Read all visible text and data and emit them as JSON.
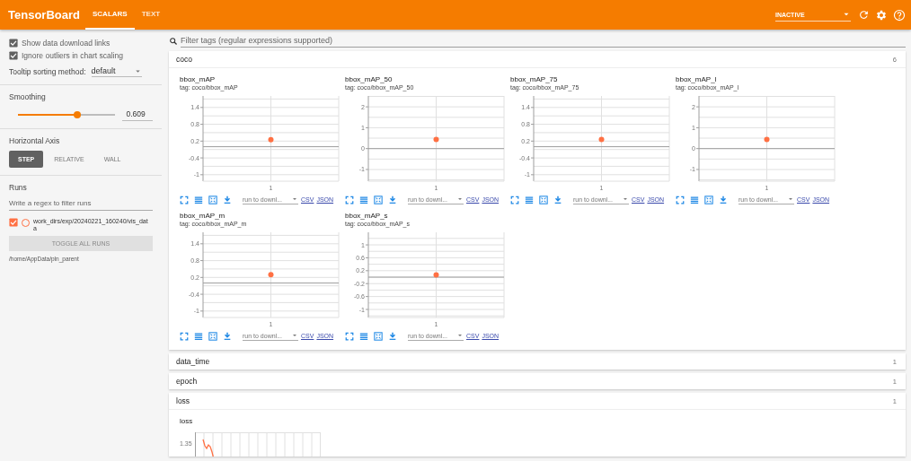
{
  "header": {
    "title": "TensorBoard",
    "tabs": [
      {
        "label": "SCALARS",
        "selected": true
      },
      {
        "label": "TEXT",
        "selected": false
      }
    ],
    "run_status": "INACTIVE"
  },
  "sidebar": {
    "options": [
      {
        "label": "Show data download links",
        "checked": true
      },
      {
        "label": "Ignore outliers in chart scaling",
        "checked": true
      }
    ],
    "tooltip_sorting": {
      "label": "Tooltip sorting method:",
      "value": "default"
    },
    "smoothing": {
      "label": "Smoothing",
      "level": 0.609,
      "reading": "0.609"
    },
    "horizontal_axis": {
      "label": "Horizontal Axis",
      "options": [
        {
          "label": "STEP",
          "selected": true
        },
        {
          "label": "RELATIVE",
          "selected": false
        },
        {
          "label": "WALL",
          "selected": false
        }
      ]
    },
    "runs": {
      "label": "Runs",
      "filter_placeholder": "Write a regex to filter runs",
      "items": [
        {
          "name": "work_dirs/exp/20240221_160240/vis_data",
          "checked": true,
          "selected": false,
          "color": "#ff7043"
        }
      ],
      "toggle_button": "TOGGLE ALL RUNS",
      "log_dir": "/home/AppData/pln_parent"
    }
  },
  "main": {
    "search_placeholder": "Filter tags (regular expressions supported)",
    "categories": [
      {
        "name": "coco",
        "count": "6",
        "expanded": true,
        "kind": "charts",
        "charts": [
          {
            "title": "bbox_mAP",
            "tag": "tag: coco/bbox_mAP",
            "download_placeholder": "run to downl...",
            "links": [
              "CSV",
              "JSON"
            ],
            "chart_data": {
              "type": "scatter",
              "categories": [
                "1"
              ],
              "grid": true,
              "ylim": [
                -1.23,
                1.81
              ],
              "yticks": [
                1.4,
                0.8,
                0.2,
                -0.4,
                -1
              ],
              "series": [
                {
                  "color": "#ff7043",
                  "values": [
                    0.25
                  ]
                }
              ]
            }
          },
          {
            "title": "bbox_mAP_50",
            "tag": "tag: coco/bbox_mAP_50",
            "download_placeholder": "run to downl...",
            "links": [
              "CSV",
              "JSON"
            ],
            "chart_data": {
              "type": "scatter",
              "categories": [
                "1"
              ],
              "grid": true,
              "ylim": [
                -1.56,
                2.52
              ],
              "yticks": [
                2,
                1,
                0,
                -1
              ],
              "series": [
                {
                  "color": "#ff7043",
                  "values": [
                    0.44
                  ]
                }
              ]
            }
          },
          {
            "title": "bbox_mAP_75",
            "tag": "tag: coco/bbox_mAP_75",
            "download_placeholder": "run to downl...",
            "links": [
              "CSV",
              "JSON"
            ],
            "chart_data": {
              "type": "scatter",
              "categories": [
                "1"
              ],
              "grid": true,
              "ylim": [
                -1.23,
                1.81
              ],
              "yticks": [
                1.4,
                0.8,
                0.2,
                -0.4,
                -1
              ],
              "series": [
                {
                  "color": "#ff7043",
                  "values": [
                    0.26
                  ]
                }
              ]
            }
          },
          {
            "title": "bbox_mAP_l",
            "tag": "tag: coco/bbox_mAP_l",
            "download_placeholder": "run to downl...",
            "links": [
              "CSV",
              "JSON"
            ],
            "chart_data": {
              "type": "scatter",
              "categories": [
                "1"
              ],
              "grid": true,
              "ylim": [
                -1.56,
                2.52
              ],
              "yticks": [
                2,
                1,
                0,
                -1
              ],
              "series": [
                {
                  "color": "#ff7043",
                  "values": [
                    0.44
                  ]
                }
              ]
            }
          },
          {
            "title": "bbox_mAP_m",
            "tag": "tag: coco/bbox_mAP_m",
            "download_placeholder": "run to downl...",
            "links": [
              "CSV",
              "JSON"
            ],
            "chart_data": {
              "type": "scatter",
              "categories": [
                "1"
              ],
              "grid": true,
              "ylim": [
                -1.23,
                1.81
              ],
              "yticks": [
                1.4,
                0.8,
                0.2,
                -0.4,
                -1
              ],
              "series": [
                {
                  "color": "#ff7043",
                  "values": [
                    0.3
                  ]
                }
              ]
            }
          },
          {
            "title": "bbox_mAP_s",
            "tag": "tag: coco/bbox_mAP_s",
            "download_placeholder": "run to downl...",
            "links": [
              "CSV",
              "JSON"
            ],
            "chart_data": {
              "type": "scatter",
              "categories": [
                "1"
              ],
              "grid": true,
              "ylim": [
                -1.25,
                1.39
              ],
              "yticks": [
                1,
                0.6,
                0.2,
                -0.2,
                -0.6,
                -1
              ],
              "series": [
                {
                  "color": "#ff7043",
                  "values": [
                    0.07
                  ]
                }
              ]
            }
          }
        ]
      },
      {
        "name": "data_time",
        "count": "1",
        "expanded": false
      },
      {
        "name": "epoch",
        "count": "1",
        "expanded": false
      },
      {
        "name": "loss",
        "count": "1",
        "expanded": true,
        "kind": "preview",
        "preview": {
          "title": "loss",
          "tick_label": "1.35"
        }
      }
    ]
  }
}
